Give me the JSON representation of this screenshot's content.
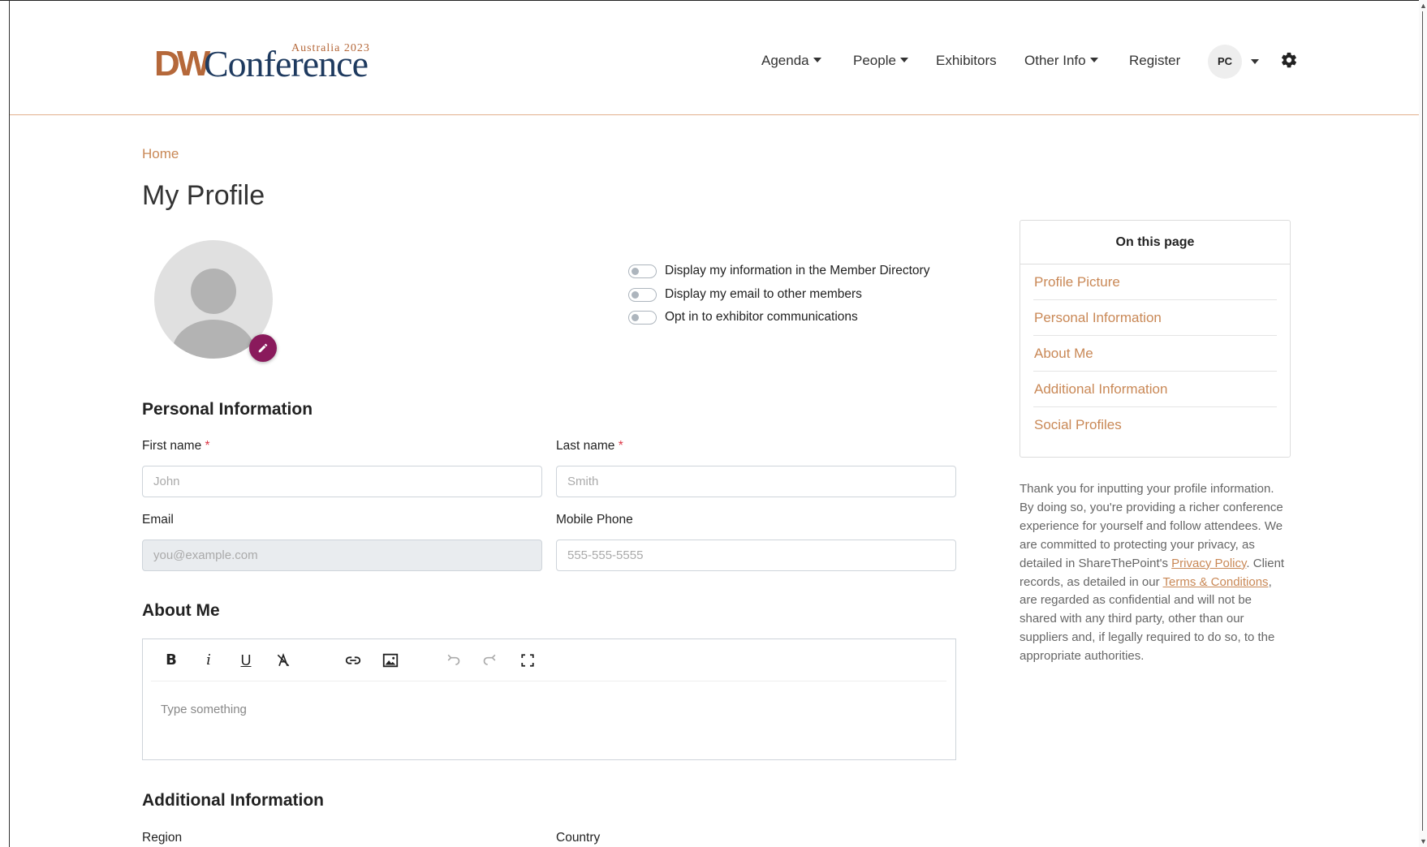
{
  "logo": {
    "brand_dw": "DW",
    "brand_name": "Conference",
    "subtitle": "Australia 2023"
  },
  "nav": {
    "items": [
      {
        "label": "Agenda",
        "dropdown": true
      },
      {
        "label": "People",
        "dropdown": true
      },
      {
        "label": "Exhibitors",
        "dropdown": false
      },
      {
        "label": "Other Info",
        "dropdown": true
      },
      {
        "label": "Register",
        "dropdown": false
      }
    ],
    "user_initials": "PC"
  },
  "breadcrumb": {
    "home": "Home"
  },
  "page": {
    "title": "My Profile"
  },
  "toggles": [
    {
      "label": "Display my information in the Member Directory",
      "on": false
    },
    {
      "label": "Display my email to other members",
      "on": false
    },
    {
      "label": "Opt in to exhibitor communications",
      "on": false
    }
  ],
  "personal": {
    "heading": "Personal Information",
    "first_name_label": "First name",
    "first_name_placeholder": "John",
    "last_name_label": "Last name",
    "last_name_placeholder": "Smith",
    "required_mark": "*",
    "email_label": "Email",
    "email_placeholder": "you@example.com",
    "phone_label": "Mobile Phone",
    "phone_placeholder": "555-555-5555"
  },
  "about": {
    "heading": "About Me",
    "placeholder": "Type something",
    "toolbar": [
      "bold-icon",
      "italic-icon",
      "underline-icon",
      "clear-format-icon",
      "link-icon",
      "image-icon",
      "undo-icon",
      "redo-icon",
      "fullscreen-icon"
    ]
  },
  "additional": {
    "heading": "Additional Information",
    "region_label": "Region",
    "country_label": "Country"
  },
  "on_this_page": {
    "title": "On this page",
    "links": [
      "Profile Picture",
      "Personal Information",
      "About Me",
      "Additional Information",
      "Social Profiles"
    ]
  },
  "privacy": {
    "text_1": "Thank you for inputting your profile information. By doing so, you're providing a richer conference experience for yourself and follow attendees. We are committed to protecting your privacy, as detailed in ShareThePoint's ",
    "privacy_link": "Privacy Policy",
    "text_2": ". Client records, as detailed in our ",
    "terms_link": "Terms & Conditions",
    "text_3": ", are regarded as confidential and will not be shared with any third party, other than our suppliers and, if legally required to do so, to the appropriate authorities."
  },
  "colors": {
    "accent": "#c98856",
    "edit_button": "#8a1a5c",
    "logo_navy": "#1e3a5f",
    "logo_copper": "#b5683a"
  }
}
